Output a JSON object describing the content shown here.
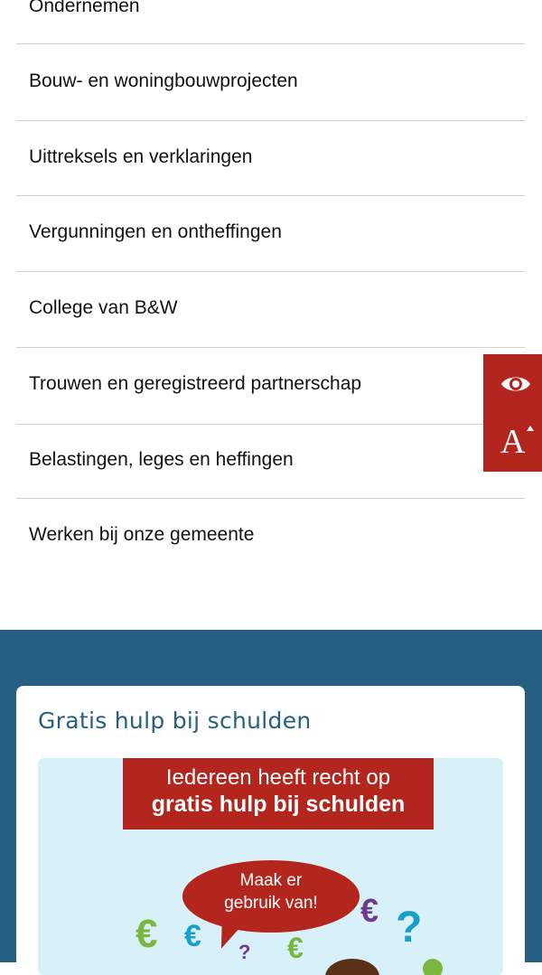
{
  "menu": {
    "items": [
      {
        "label": "Ondernemen"
      },
      {
        "label": "Bouw- en woningbouwprojecten"
      },
      {
        "label": "Uittreksels en verklaringen"
      },
      {
        "label": "Vergunningen en ontheffingen"
      },
      {
        "label": "College van B&W"
      },
      {
        "label": "Trouwen en geregistreerd partnerschap"
      },
      {
        "label": "Belastingen, leges en heffingen"
      },
      {
        "label": "Werken bij onze gemeente"
      }
    ]
  },
  "accessibility": {
    "read_aloud_icon": "eye-icon",
    "text_size_label": "A",
    "text_size_icon": "text-size-icon"
  },
  "promo": {
    "card_title": "Gratis hulp bij schulden",
    "banner_line1": "Iedereen heeft recht op",
    "banner_line2": "gratis hulp bij schulden",
    "bubble_line1": "Maak er",
    "bubble_line2": "gebruik van!"
  },
  "colors": {
    "brand_red": "#b3261e",
    "brand_blue": "#255f82",
    "illustration_bg": "#d8f0f7",
    "euro_green": "#7ab640",
    "teal": "#1aa0c8",
    "purple": "#6e3b8f"
  }
}
